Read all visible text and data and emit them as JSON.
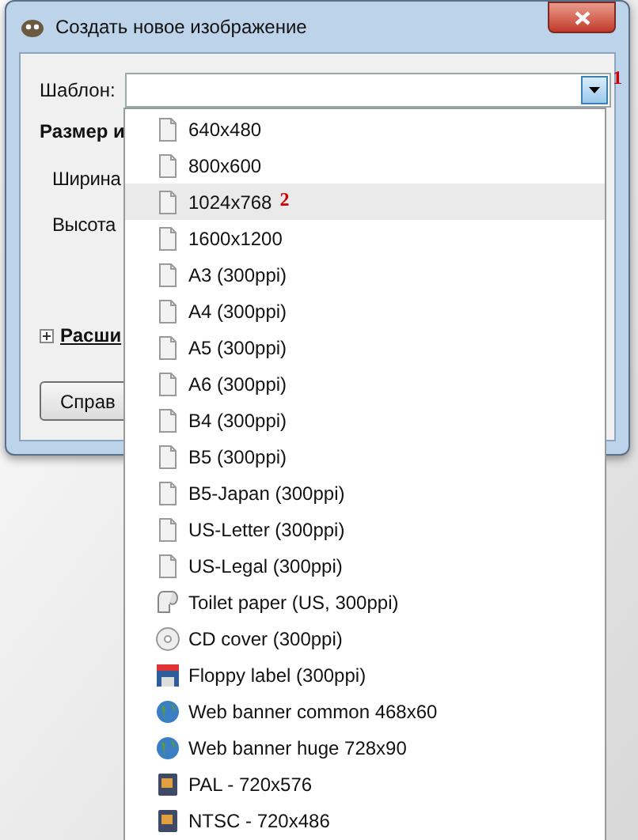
{
  "window": {
    "title": "Создать новое изображение"
  },
  "template": {
    "label": "Шаблон:",
    "value_marker": "1"
  },
  "size_section": {
    "heading": "Размер и",
    "width_label": "Ширина",
    "height_label": "Высота"
  },
  "advanced": {
    "label": "Расши",
    "expanded": false
  },
  "buttons": [
    "Справ"
  ],
  "dropdown": {
    "items": [
      {
        "label": "640x480",
        "kind": "page",
        "selected": false
      },
      {
        "label": "800x600",
        "kind": "page",
        "selected": false
      },
      {
        "label": "1024x768",
        "kind": "page",
        "selected": true,
        "marker": "2"
      },
      {
        "label": "1600x1200",
        "kind": "page",
        "selected": false
      },
      {
        "label": "A3 (300ppi)",
        "kind": "page",
        "selected": false
      },
      {
        "label": "A4 (300ppi)",
        "kind": "page",
        "selected": false
      },
      {
        "label": "A5 (300ppi)",
        "kind": "page",
        "selected": false
      },
      {
        "label": "A6 (300ppi)",
        "kind": "page",
        "selected": false
      },
      {
        "label": "B4 (300ppi)",
        "kind": "page",
        "selected": false
      },
      {
        "label": "B5 (300ppi)",
        "kind": "page",
        "selected": false
      },
      {
        "label": "B5-Japan (300ppi)",
        "kind": "page",
        "selected": false
      },
      {
        "label": "US-Letter (300ppi)",
        "kind": "page",
        "selected": false
      },
      {
        "label": "US-Legal (300ppi)",
        "kind": "page",
        "selected": false
      },
      {
        "label": "Toilet paper (US, 300ppi)",
        "kind": "roll",
        "selected": false
      },
      {
        "label": "CD cover (300ppi)",
        "kind": "disc",
        "selected": false
      },
      {
        "label": "Floppy label (300ppi)",
        "kind": "floppy",
        "selected": false
      },
      {
        "label": "Web banner common 468x60",
        "kind": "globe",
        "selected": false
      },
      {
        "label": "Web banner huge 728x90",
        "kind": "globe",
        "selected": false
      },
      {
        "label": "PAL - 720x576",
        "kind": "video",
        "selected": false
      },
      {
        "label": "NTSC - 720x486",
        "kind": "video",
        "selected": false
      }
    ]
  }
}
